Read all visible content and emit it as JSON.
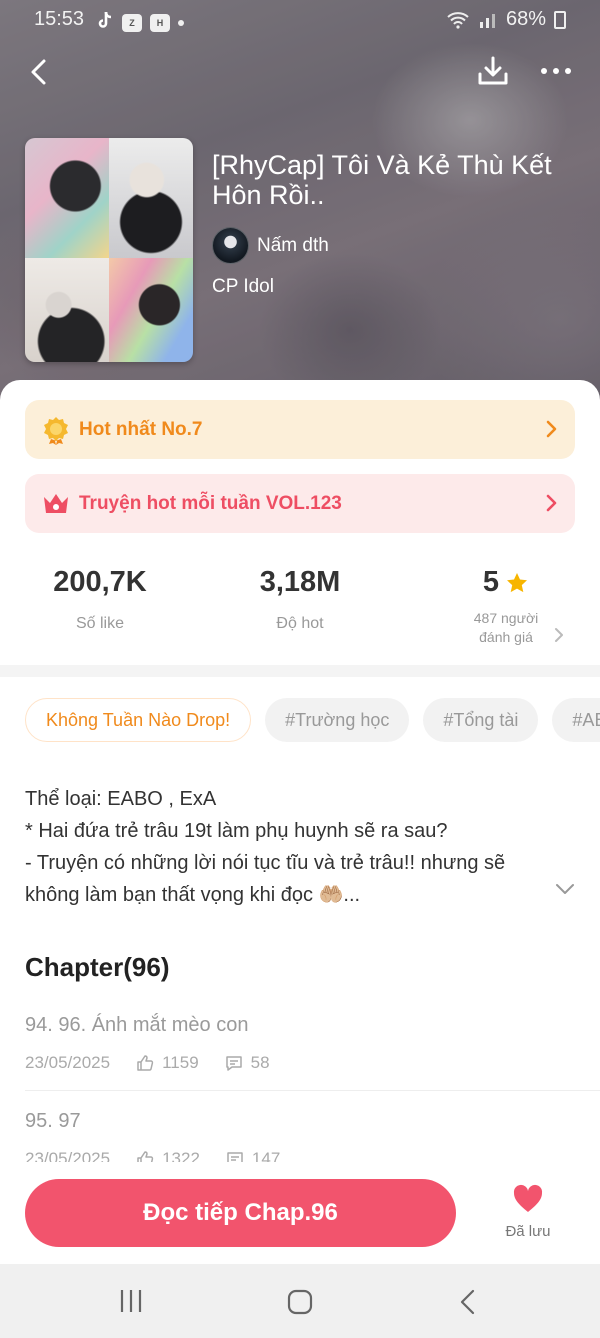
{
  "status_bar": {
    "time": "15:53",
    "battery": "68%",
    "app_icons": [
      "tiktok-icon",
      "zalo-icon",
      "h-app-icon"
    ]
  },
  "header": {
    "back_icon": "chevron-left-icon",
    "download_icon": "download-icon",
    "more_icon": "more-dots-icon"
  },
  "book": {
    "title": "[RhyCap] Tôi Và Kẻ Thù Kết Hôn Rồi..",
    "author": "Nấm dth",
    "category": "CP Idol"
  },
  "banners": [
    {
      "label": "Hot nhất No.7",
      "icon": "medal-icon",
      "color": "#f08a1c"
    },
    {
      "label": "Truyện hot mỗi tuần VOL.123",
      "icon": "crown-icon",
      "color": "#ee4e63"
    }
  ],
  "stats": {
    "likes": {
      "value": "200,7K",
      "label": "Số like"
    },
    "hot": {
      "value": "3,18M",
      "label": "Độ hot"
    },
    "rating": {
      "value": "5",
      "line1": "487 người",
      "line2": "đánh giá"
    }
  },
  "tags": [
    "Không Tuần Nào Drop!",
    "#Trường học",
    "#Tổng tài",
    "#ABO"
  ],
  "description": {
    "line1": "Thể loại: EABO , ExA",
    "line2": "* Hai đứa trẻ trâu 19t làm phụ huynh sẽ ra sau?",
    "line3": "- Truyện có những lời nói tục tĩu và trẻ trâu!! nhưng sẽ",
    "line4": "không làm bạn thất vọng khi đọc 🤲🏼..."
  },
  "chapters": {
    "heading": "Chapter(96)",
    "items": [
      {
        "title": "94. 96. Ánh mắt mèo con",
        "date": "23/05/2025",
        "likes": "1159",
        "comments": "58"
      },
      {
        "title": "95. 97",
        "date": "23/05/2025",
        "likes": "1322",
        "comments": "147"
      }
    ]
  },
  "bottom": {
    "read_button": "Đọc tiếp Chap.96",
    "saved_label": "Đã lưu"
  },
  "colors": {
    "accent": "#f2546d",
    "hot_orange": "#f08a1c",
    "star": "#f7b500"
  }
}
